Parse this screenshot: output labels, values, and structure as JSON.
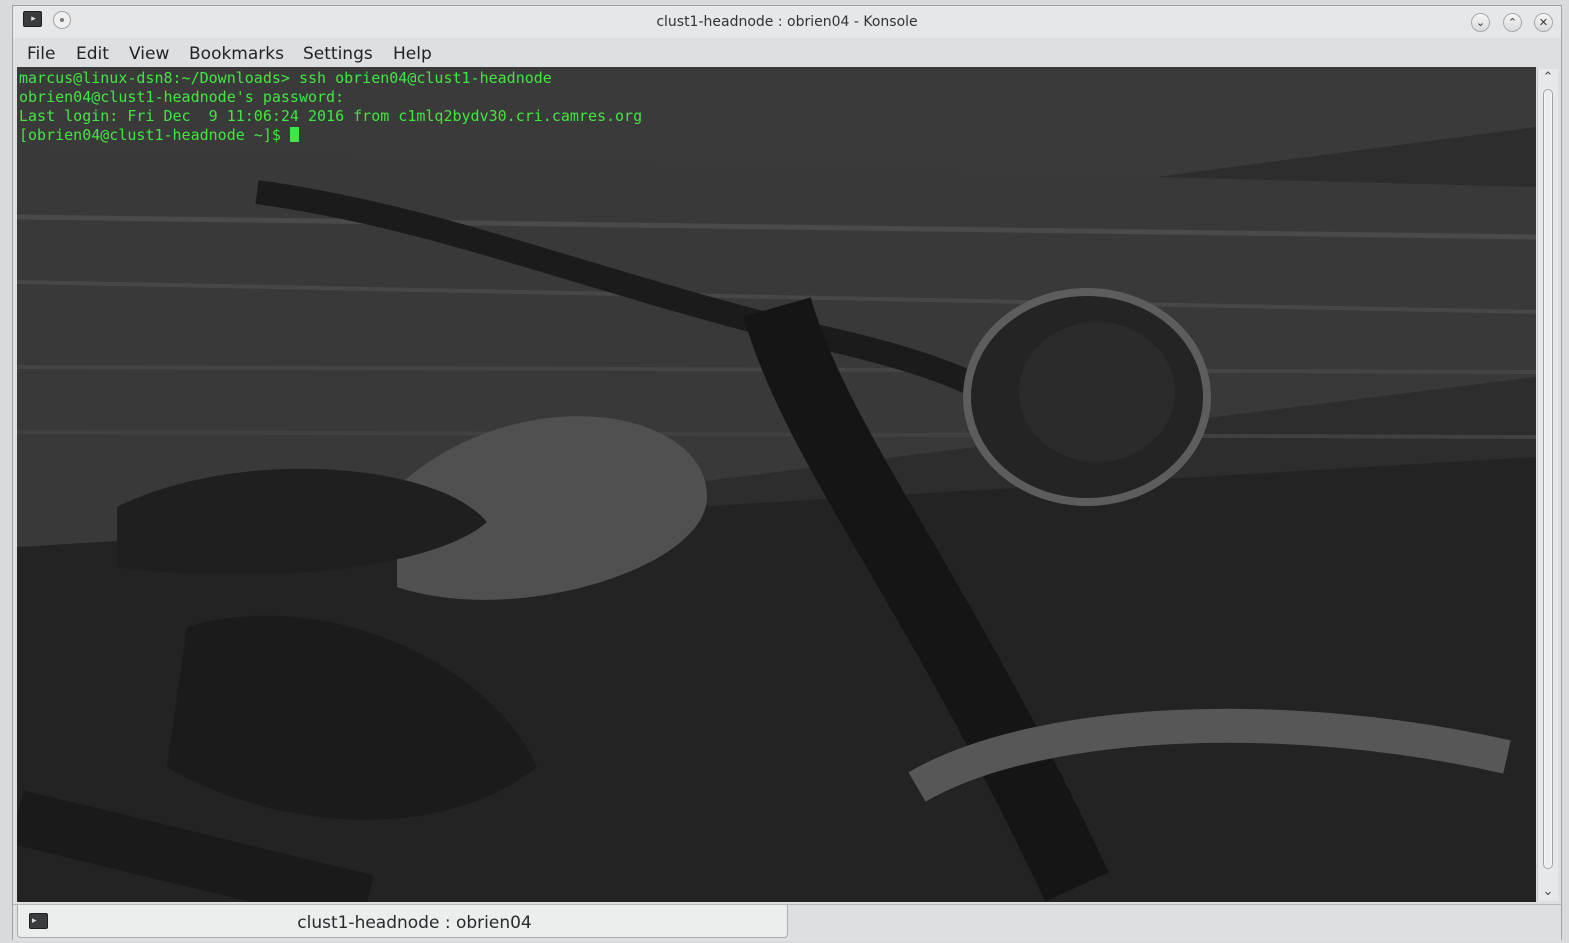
{
  "window": {
    "title": "clust1-headnode : obrien04 - Konsole",
    "icon": "terminal-icon"
  },
  "title_controls": {
    "pin_icon": "pin-icon",
    "minimize": "⌄",
    "maximize": "⌃",
    "close": "✕"
  },
  "menu": [
    "File",
    "Edit",
    "View",
    "Bookmarks",
    "Settings",
    "Help"
  ],
  "terminal": {
    "lines": [
      "marcus@linux-dsn8:~/Downloads> ssh obrien04@clust1-headnode",
      "obrien04@clust1-headnode's password:",
      "Last login: Fri Dec  9 11:06:24 2016 from c1mlq2bydv30.cri.camres.org",
      "[obrien04@clust1-headnode ~]$ "
    ],
    "text_color": "#42e642",
    "background": "dark motorcycle photo wallpaper"
  },
  "scrollbar": {
    "up": "⌃",
    "down": "⌄"
  },
  "tabs": [
    {
      "label": "clust1-headnode : obrien04",
      "icon": "terminal-icon"
    }
  ],
  "colors": {
    "chrome": "#dedfe1",
    "terminal_bg": "#262626",
    "prompt_green": "#42e642"
  }
}
